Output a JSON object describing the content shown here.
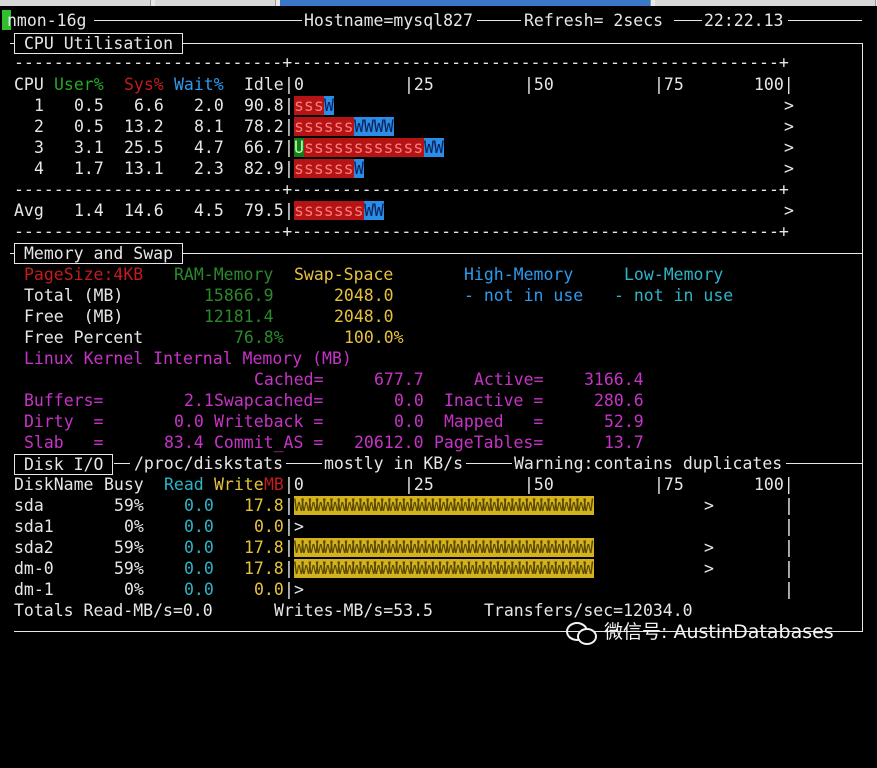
{
  "header": {
    "program": "nmon-16g",
    "hostname": "Hostname=mysql827",
    "refresh": "Refresh= 2secs",
    "time": "22:22.13"
  },
  "cpu": {
    "title": "CPU Utilisation",
    "dashes": "---------------------------+-------------------------------------------------+",
    "headers": {
      "cpu": "CPU",
      "user": "User%",
      "sys": "Sys%",
      "wait": "Wait%",
      "idle": "Idle"
    },
    "scale": [
      "0",
      "|25",
      "|50",
      "|75",
      "100|"
    ],
    "rows": [
      {
        "cpu": "1",
        "user": "0.5",
        "sys": "6.6",
        "wait": "2.0",
        "idle": "90.8",
        "bar_u": "",
        "bar_s": "sss",
        "bar_w": "W",
        "end": ">"
      },
      {
        "cpu": "2",
        "user": "0.5",
        "sys": "13.2",
        "wait": "8.1",
        "idle": "78.2",
        "bar_u": "",
        "bar_s": "ssssss",
        "bar_w": "WWWW",
        "end": ">"
      },
      {
        "cpu": "3",
        "user": "3.1",
        "sys": "25.5",
        "wait": "4.7",
        "idle": "66.7",
        "bar_u": "U",
        "bar_s": "ssssssssssss",
        "bar_w": "WW",
        "end": ">"
      },
      {
        "cpu": "4",
        "user": "1.7",
        "sys": "13.1",
        "wait": "2.3",
        "idle": "82.9",
        "bar_u": "",
        "bar_s": "ssssss",
        "bar_w": "W",
        "end": ">"
      }
    ],
    "avg": {
      "label": "Avg",
      "user": "1.4",
      "sys": "14.6",
      "wait": "4.5",
      "idle": "79.5",
      "bar_s": "sssssss",
      "bar_w": "WW",
      "end": ">"
    }
  },
  "memory": {
    "title": "Memory and Swap",
    "pagesize": "PageSize:4KB",
    "col_ram": "RAM-Memory",
    "col_swap": "Swap-Space",
    "col_high": "High-Memory",
    "col_low": "Low-Memory",
    "total_label": "Total (MB)",
    "total_ram": "15866.9",
    "total_swap": "2048.0",
    "high_nu": "- not in use",
    "low_nu": "- not in use",
    "free_label": "Free  (MB)",
    "free_ram": "12181.4",
    "free_swap": "2048.0",
    "freepct_label": "Free Percent",
    "freepct_ram": "76.8%",
    "freepct_swap": "100.0%",
    "kernel_title": "Linux Kernel Internal Memory (MB)",
    "cached_label": "Cached=",
    "cached": "677.7",
    "active_label": "Active=",
    "active": "3166.4",
    "buffers_label": "Buffers=",
    "buffers": "2.1",
    "swapcached_label": "Swapcached=",
    "swapcached": "0.0",
    "inactive_label": "Inactive =",
    "inactive": "280.6",
    "dirty_label": "Dirty  =",
    "dirty": "0.0",
    "writeback_label": "Writeback =",
    "writeback": "0.0",
    "mapped_label": "Mapped   =",
    "mapped": "52.9",
    "slab_label": "Slab   =",
    "slab": "83.4",
    "commit_label": "Commit_AS =",
    "commit": "20612.0",
    "pagetables_label": "PageTables=",
    "pagetables": "13.7"
  },
  "disk": {
    "title": "Disk I/O",
    "source": "/proc/diskstats",
    "units": "mostly in KB/s",
    "warning": "Warning:contains duplicates",
    "headers": {
      "name": "DiskName",
      "busy": "Busy",
      "read": "Read",
      "write": "Write",
      "mb": "MB"
    },
    "scale": [
      "|0",
      "|25",
      "|50",
      "|75",
      "100|"
    ],
    "rows": [
      {
        "name": "sda",
        "busy": "59%",
        "read": "0.0",
        "write": "17.8",
        "bar": "WWWWWWWWWWWWWWWWWWWWWWWWWWWWWWWWWWWWWWWWW",
        "end": ">",
        "tail": "|"
      },
      {
        "name": "sda1",
        "busy": "0%",
        "read": "0.0",
        "write": "0.0",
        "bar": "",
        "end": ">",
        "tail": "|"
      },
      {
        "name": "sda2",
        "busy": "59%",
        "read": "0.0",
        "write": "17.8",
        "bar": "WWWWWWWWWWWWWWWWWWWWWWWWWWWWWWWWWWWWWWWWW",
        "end": ">",
        "tail": "|"
      },
      {
        "name": "dm-0",
        "busy": "59%",
        "read": "0.0",
        "write": "17.8",
        "bar": "WWWWWWWWWWWWWWWWWWWWWWWWWWWWWWWWWWWWWWWWW",
        "end": ">",
        "tail": "|"
      },
      {
        "name": "dm-1",
        "busy": "0%",
        "read": "0.0",
        "write": "0.0",
        "bar": "",
        "end": ">",
        "tail": "|"
      }
    ],
    "totals_read": "Totals Read-MB/s=0.0",
    "totals_write": "Writes-MB/s=53.5",
    "totals_tps": "Transfers/sec=12034.0"
  },
  "watermark": {
    "text": "微信号: AustinDatabases"
  }
}
